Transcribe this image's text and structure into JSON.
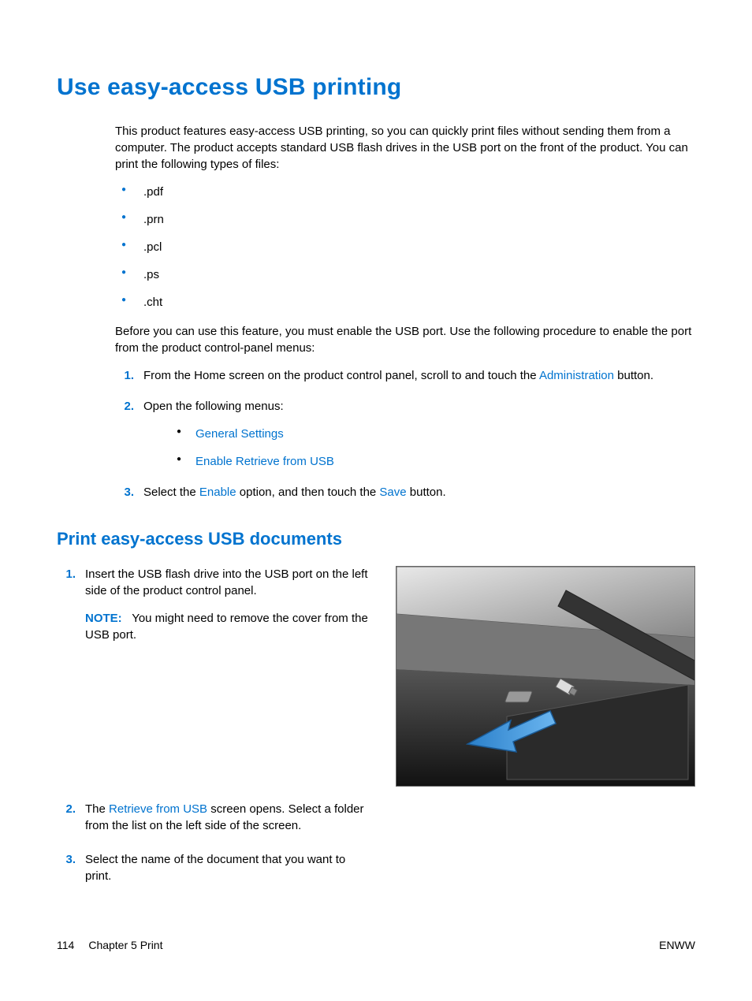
{
  "title": "Use easy-access USB printing",
  "intro": "This product features easy-access USB printing, so you can quickly print files without sending them from a computer. The product accepts standard USB flash drives in the USB port on the front of the product. You can print the following types of files:",
  "file_types": [
    ".pdf",
    ".prn",
    ".pcl",
    ".ps",
    ".cht"
  ],
  "enable_intro": "Before you can use this feature, you must enable the USB port. Use the following procedure to enable the port from the product control-panel menus:",
  "enable_steps": {
    "s1_pre": "From the Home screen on the product control panel, scroll to and touch the ",
    "s1_term": "Administration",
    "s1_post": " button.",
    "s2": "Open the following menus:",
    "s2_menus": [
      "General Settings",
      "Enable Retrieve from USB"
    ],
    "s3_pre": "Select the ",
    "s3_t1": "Enable",
    "s3_mid": " option, and then touch the ",
    "s3_t2": "Save",
    "s3_post": " button."
  },
  "subhead": "Print easy-access USB documents",
  "print_steps": {
    "s1": "Insert the USB flash drive into the USB port on the left side of the product control panel.",
    "note_label": "NOTE:",
    "note_body": "You might need to remove the cover from the USB port.",
    "s2_pre": "The ",
    "s2_term": "Retrieve from USB",
    "s2_post": " screen opens. Select a folder from the list on the left side of the screen.",
    "s3": "Select the name of the document that you want to print."
  },
  "footer": {
    "page_num": "114",
    "chapter": "Chapter 5   Print",
    "lang": "ENWW"
  }
}
